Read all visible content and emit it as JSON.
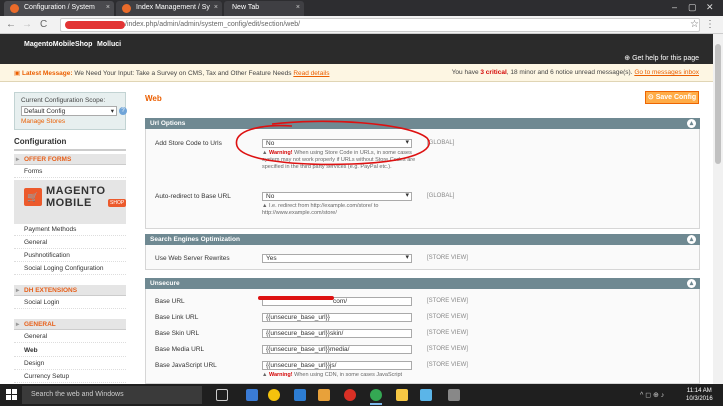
{
  "browser": {
    "tabs": [
      {
        "label": "Configuration / System"
      },
      {
        "label": "Index Management / Sy"
      },
      {
        "label": "New Tab"
      }
    ],
    "window_controls": {
      "min": "–",
      "max": "▢",
      "close": "✕"
    },
    "nav": {
      "back": "←",
      "forward": "→",
      "reload": "C"
    },
    "url_path": "/index.php/admin/admin/system_config/edit/section/web/",
    "star": "☆",
    "menu": "⋮"
  },
  "header": {
    "links": [
      "MagentoMobileShop",
      "Molluci"
    ],
    "help": "Get help for this page"
  },
  "message_bar": {
    "latest_label": "Latest Message:",
    "latest_text": "We Need Your Input: Take a Survey on CMS, Tax and Other Feature Needs",
    "read_details": "Read details",
    "prefix": "You have",
    "critical": "3 critical",
    "rest": ", 18 minor and 6 notice unread message(s).",
    "goto": "Go to messages inbox"
  },
  "sidebar": {
    "scope_label": "Current Configuration Scope:",
    "scope_value": "Default Config",
    "help_q": "?",
    "manage_stores": "Manage Stores",
    "config_heading": "Configuration",
    "offer_forms": "OFFER FORMS",
    "forms": "Forms",
    "logo_top": "MAGENTO",
    "logo_bottom": "MOBILE",
    "logo_badge": "SHOP",
    "logo_icon": "🛒",
    "items_after_logo": [
      "Payment Methods",
      "General",
      "Pushnotification",
      "Social Loging Configuration"
    ],
    "dh_extensions": "DH EXTENSIONS",
    "social_login": "Social Login",
    "general_section": "GENERAL",
    "general_items": [
      "General",
      "Web",
      "Design",
      "Currency Setup"
    ]
  },
  "main": {
    "page_title": "Web",
    "save_button": "Save Config",
    "url_options": {
      "title": "Url Options",
      "add_store_code_label": "Add Store Code to Urls",
      "add_store_code_value": "No",
      "add_store_code_scope": "[GLOBAL]",
      "warning_label": "Warning!",
      "warning_text": "When using Store Code in URLs, in some cases system may not work properly if URLs without Store Codes are specified in the third party services (e.g. PayPal etc.).",
      "auto_redirect_label": "Auto-redirect to Base URL",
      "auto_redirect_value": "No",
      "auto_redirect_scope": "[GLOBAL]",
      "auto_redirect_note": "I.e. redirect from http://example.com/store/ to http://www.example.com/store/"
    },
    "seo": {
      "title": "Search Engines Optimization",
      "rewrites_label": "Use Web Server Rewrites",
      "rewrites_value": "Yes",
      "rewrites_scope": "[STORE VIEW]"
    },
    "unsecure": {
      "title": "Unsecure",
      "rows": [
        {
          "label": "Base URL",
          "value": "com/",
          "scope": "[STORE VIEW]"
        },
        {
          "label": "Base Link URL",
          "value": "{{unsecure_base_url}}",
          "scope": "[STORE VIEW]"
        },
        {
          "label": "Base Skin URL",
          "value": "{{unsecure_base_url}}skin/",
          "scope": "[STORE VIEW]"
        },
        {
          "label": "Base Media URL",
          "value": "{{unsecure_base_url}}media/",
          "scope": "[STORE VIEW]"
        },
        {
          "label": "Base JavaScript URL",
          "value": "{{unsecure_base_url}}js/",
          "scope": "[STORE VIEW]"
        }
      ],
      "js_warning_label": "Warning!",
      "js_warning_text": "When using CDN, in some cases JavaScript"
    }
  },
  "taskbar": {
    "search_placeholder": "Search the web and Windows",
    "time": "11:14 AM",
    "date": "10/3/2016",
    "tray": "^ ◻ ⊕ ♪"
  }
}
